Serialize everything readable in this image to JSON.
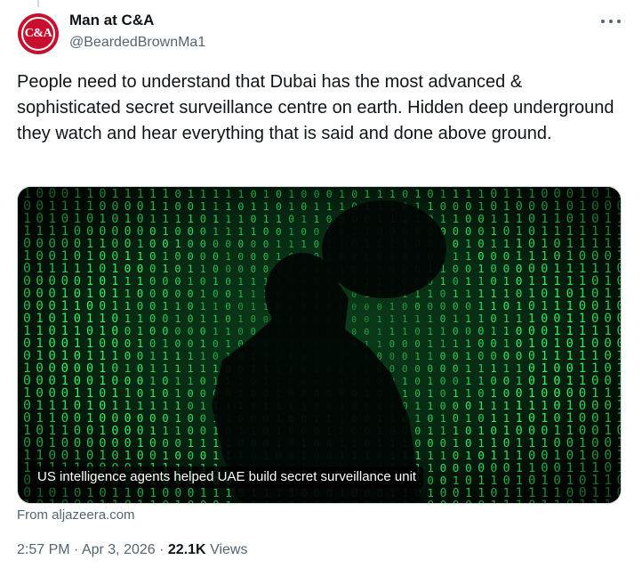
{
  "author": {
    "display_name": "Man at C&A",
    "handle": "@BeardedBrownMa1",
    "avatar_logo_text": "C&A"
  },
  "tweet": {
    "text": "People need to understand that Dubai has the most advanced & sophisticated secret surveillance centre on earth. Hidden deep underground they watch and hear everything that is said and done above ground."
  },
  "card": {
    "caption": "US intelligence agents helped UAE build secret surveillance unit",
    "source": "From aljazeera.com"
  },
  "meta": {
    "time": "2:57 PM",
    "separator": "·",
    "date": "Apr 3, 2026",
    "views_count": "22.1K",
    "views_label": "Views"
  },
  "colors": {
    "brand_red": "#c8102e",
    "text_primary": "#0f1419",
    "text_secondary": "#536471",
    "matrix_green": "#39ff6a"
  },
  "icons": {
    "more": "more-dots-icon"
  }
}
